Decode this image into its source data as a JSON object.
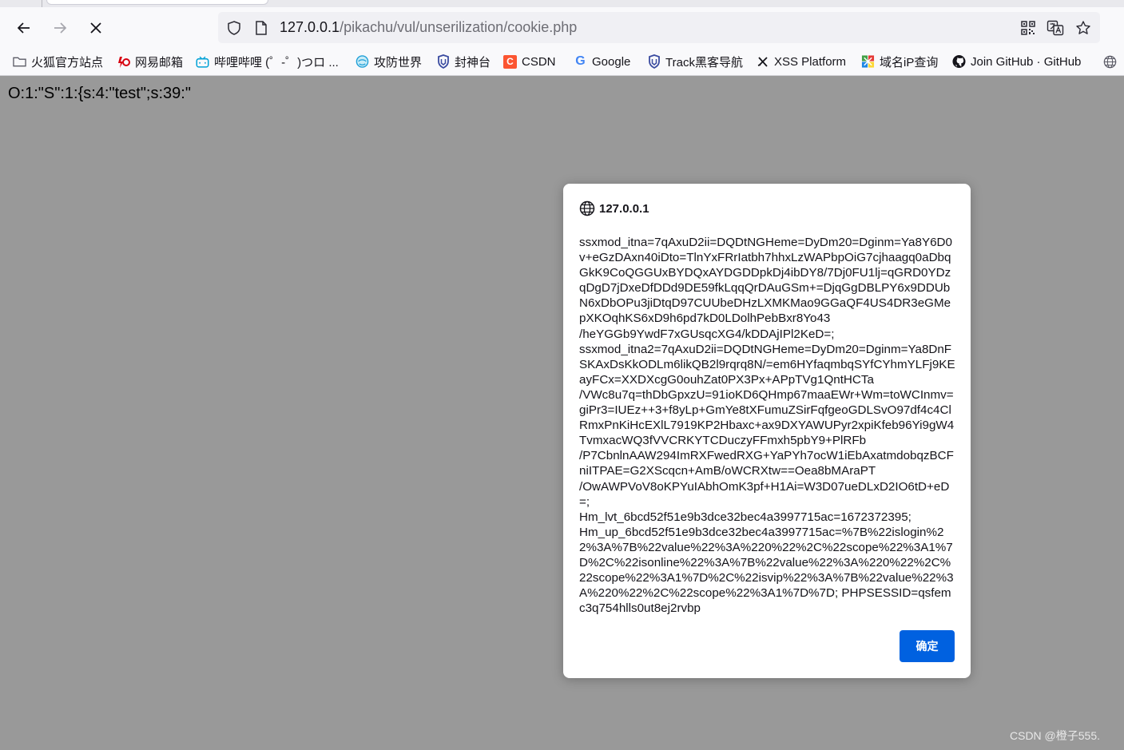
{
  "browser": {
    "url_host": "127.0.0.1",
    "url_path": "/pikachu/vul/unserilization/cookie.php"
  },
  "bookmarks": [
    {
      "label": "火狐官方站点",
      "icon": "folder-icon",
      "color": "#5b5b66"
    },
    {
      "label": "网易邮箱",
      "icon": "netease-icon",
      "color": "#d7000f"
    },
    {
      "label": "哔哩哔哩 (゜-゜)つロ ...",
      "icon": "bilibili-icon",
      "color": "#00a1d6"
    },
    {
      "label": "攻防世界",
      "icon": "globe-icon",
      "color": "#21a0d8"
    },
    {
      "label": "封神台",
      "icon": "shield-icon",
      "color": "#3a4ba0"
    },
    {
      "label": "CSDN",
      "icon": "csdn-icon",
      "color": "#fc5531"
    },
    {
      "label": "Google",
      "icon": "google-icon",
      "color": "#4285f4"
    },
    {
      "label": "Track黑客导航",
      "icon": "shield-icon",
      "color": "#3a4ba0"
    },
    {
      "label": "XSS Platform",
      "icon": "xss-icon",
      "color": "#15141a"
    },
    {
      "label": "域名iP查询",
      "icon": "domain-icon",
      "color": "#43a047"
    },
    {
      "label": "Join GitHub · GitHub",
      "icon": "github-icon",
      "color": "#15141a"
    }
  ],
  "page": {
    "serialized_text": "O:1:\"S\":1:{s:4:\"test\";s:39:\""
  },
  "dialog": {
    "title": "127.0.0.1",
    "message": "ssxmod_itna=7qAxuD2ii=DQDtNGHeme=DyDm20=Dginm=Ya8Y6D0v+eGzDAxn40iDto=TlnYxFRrIatbh7hhxLzWAPbpOiG7cjhaagq0aDbqGkK9CoQGGUxBYDQxAYDGDDpkDj4ibDY8/7Dj0FU1lj=qGRD0YDzqDgD7jDxeDfDDd9DE59fkLqqQrDAuGSm+=DjqGgDBLPY6x9DDUbN6xDbOPu3jiDtqD97CUUbeDHzLXMKMao9GGaQF4US4DR3eGMepXKOqhKS6xD9h6pd7kD0LDolhPebBxr8Yo43\n/heYGGb9YwdF7xGUsqcXG4/kDDAjIPl2KeD=;\nssxmod_itna2=7qAxuD2ii=DQDtNGHeme=DyDm20=Dginm=Ya8DnFSKAxDsKkODLm6likQB2l9rqrq8N/=em6HYfaqmbqSYfCYhmYLFj9KEayFCx=XXDXcgG0ouhZat0PX3Px+APpTVg1QntHCTa\n/VWc8u7q=thDbGpxzU=91ioKD6QHmp67maaEWr+Wm=toWCInmv=giPr3=IUEz++3+f8yLp+GmYe8tXFumuZSirFqfgeoGDLSvO97df4c4ClRmxPnKiHcEXlL7919KP2Hbaxc+ax9DXYAWUPyr2xpiKfeb96Yi9gW4TvmxacWQ3fVVCRKYTCDuczyFFmxh5pbY9+PlRFb\n/P7CbnlnAAW294ImRXFwedRXG+YaPYh7ocW1iEbAxatmdobqzBCFniITPAE=G2XScqcn+AmB/oWCRXtw==Oea8bMAraPT\n/OwAWPVoV8oKPYuIAbhOmK3pf+H1Ai=W3D07ueDLxD2IO6tD+eD=;\nHm_lvt_6bcd52f51e9b3dce32bec4a3997715ac=1672372395;\nHm_up_6bcd52f51e9b3dce32bec4a3997715ac=%7B%22islogin%22%3A%7B%22value%22%3A%220%22%2C%22scope%22%3A1%7D%2C%22isonline%22%3A%7B%22value%22%3A%220%22%2C%22scope%22%3A1%7D%2C%22isvip%22%3A%7B%22value%22%3A%220%22%2C%22scope%22%3A1%7D%7D; PHPSESSID=qsfemc3q754hlls0ut8ej2rvbp",
    "ok_label": "确定",
    "ok_color": "#0061e0"
  },
  "watermark": "CSDN @橙子555."
}
